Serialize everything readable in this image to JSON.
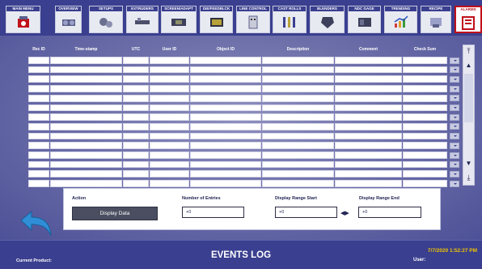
{
  "nav": [
    {
      "label": "MAIN MENU",
      "icon": "main-menu-icon"
    },
    {
      "label": "OVERVIEW",
      "icon": "overview-icon"
    },
    {
      "label": "SETUPS",
      "icon": "setups-icon"
    },
    {
      "label": "EXTRUDERS",
      "icon": "extruders-icon"
    },
    {
      "label": "SCREEN/ADAPT",
      "icon": "screen-adapt-icon"
    },
    {
      "label": "DIE/FEEDBLCK",
      "icon": "die-feedblock-icon"
    },
    {
      "label": "LINE CONTROL",
      "icon": "line-control-icon"
    },
    {
      "label": "CAST ROLLS",
      "icon": "cast-rolls-icon"
    },
    {
      "label": "BLENDERS",
      "icon": "blenders-icon"
    },
    {
      "label": "NDC GAGE",
      "icon": "ndc-gage-icon"
    },
    {
      "label": "TRENDING",
      "icon": "trending-icon"
    },
    {
      "label": "RECIPE",
      "icon": "recipe-icon"
    },
    {
      "label": "ALARMS",
      "icon": "alarms-icon"
    }
  ],
  "table": {
    "columns": [
      "Rec ID",
      "Time-stamp",
      "UTC",
      "User ID",
      "Object ID",
      "Description",
      "Comment",
      "Check Sum"
    ],
    "row_count": 14
  },
  "panel": {
    "action_label": "Action",
    "display_button": "Display Data",
    "entries_label": "Number of Entries",
    "entries_value": "+0",
    "range_start_label": "Display Range Start",
    "range_start_value": "+0",
    "range_end_label": "Display Range End",
    "range_end_value": "+0"
  },
  "footer": {
    "title": "EVENTS LOG",
    "current_product_label": "Current Product:",
    "datetime": "7/7/2020 1:52:27 PM",
    "user_label": "User:"
  },
  "colors": {
    "nav_bg": "#3a3f8f",
    "active_border": "#c0101a",
    "datetime": "#f2c400"
  }
}
